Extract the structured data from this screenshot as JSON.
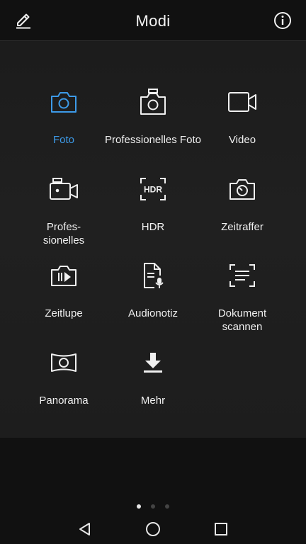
{
  "header": {
    "title": "Modi",
    "edit_icon": "pencil-icon",
    "info_icon": "info-icon"
  },
  "modes": [
    {
      "label": "Foto",
      "icon": "camera-icon",
      "active": true
    },
    {
      "label": "Professionelles Foto",
      "icon": "pro-camera-icon",
      "active": false
    },
    {
      "label": "Video",
      "icon": "video-camera-icon",
      "active": false
    },
    {
      "label": "Profes-\nsionelles",
      "icon": "pro-video-icon",
      "active": false
    },
    {
      "label": "HDR",
      "icon": "hdr-icon",
      "active": false
    },
    {
      "label": "Zeitraffer",
      "icon": "timelapse-icon",
      "active": false
    },
    {
      "label": "Zeitlupe",
      "icon": "slow-motion-icon",
      "active": false
    },
    {
      "label": "Audionotiz",
      "icon": "audio-note-icon",
      "active": false
    },
    {
      "label": "Dokument\nscannen",
      "icon": "document-scan-icon",
      "active": false
    },
    {
      "label": "Panorama",
      "icon": "panorama-icon",
      "active": false
    },
    {
      "label": "Mehr",
      "icon": "download-icon",
      "active": false
    }
  ],
  "pager": {
    "pages": 3,
    "current": 1
  },
  "navigation": [
    "back-icon",
    "home-icon",
    "recents-icon"
  ],
  "colors": {
    "accent": "#3d9be9",
    "text": "#f0f0f0"
  }
}
